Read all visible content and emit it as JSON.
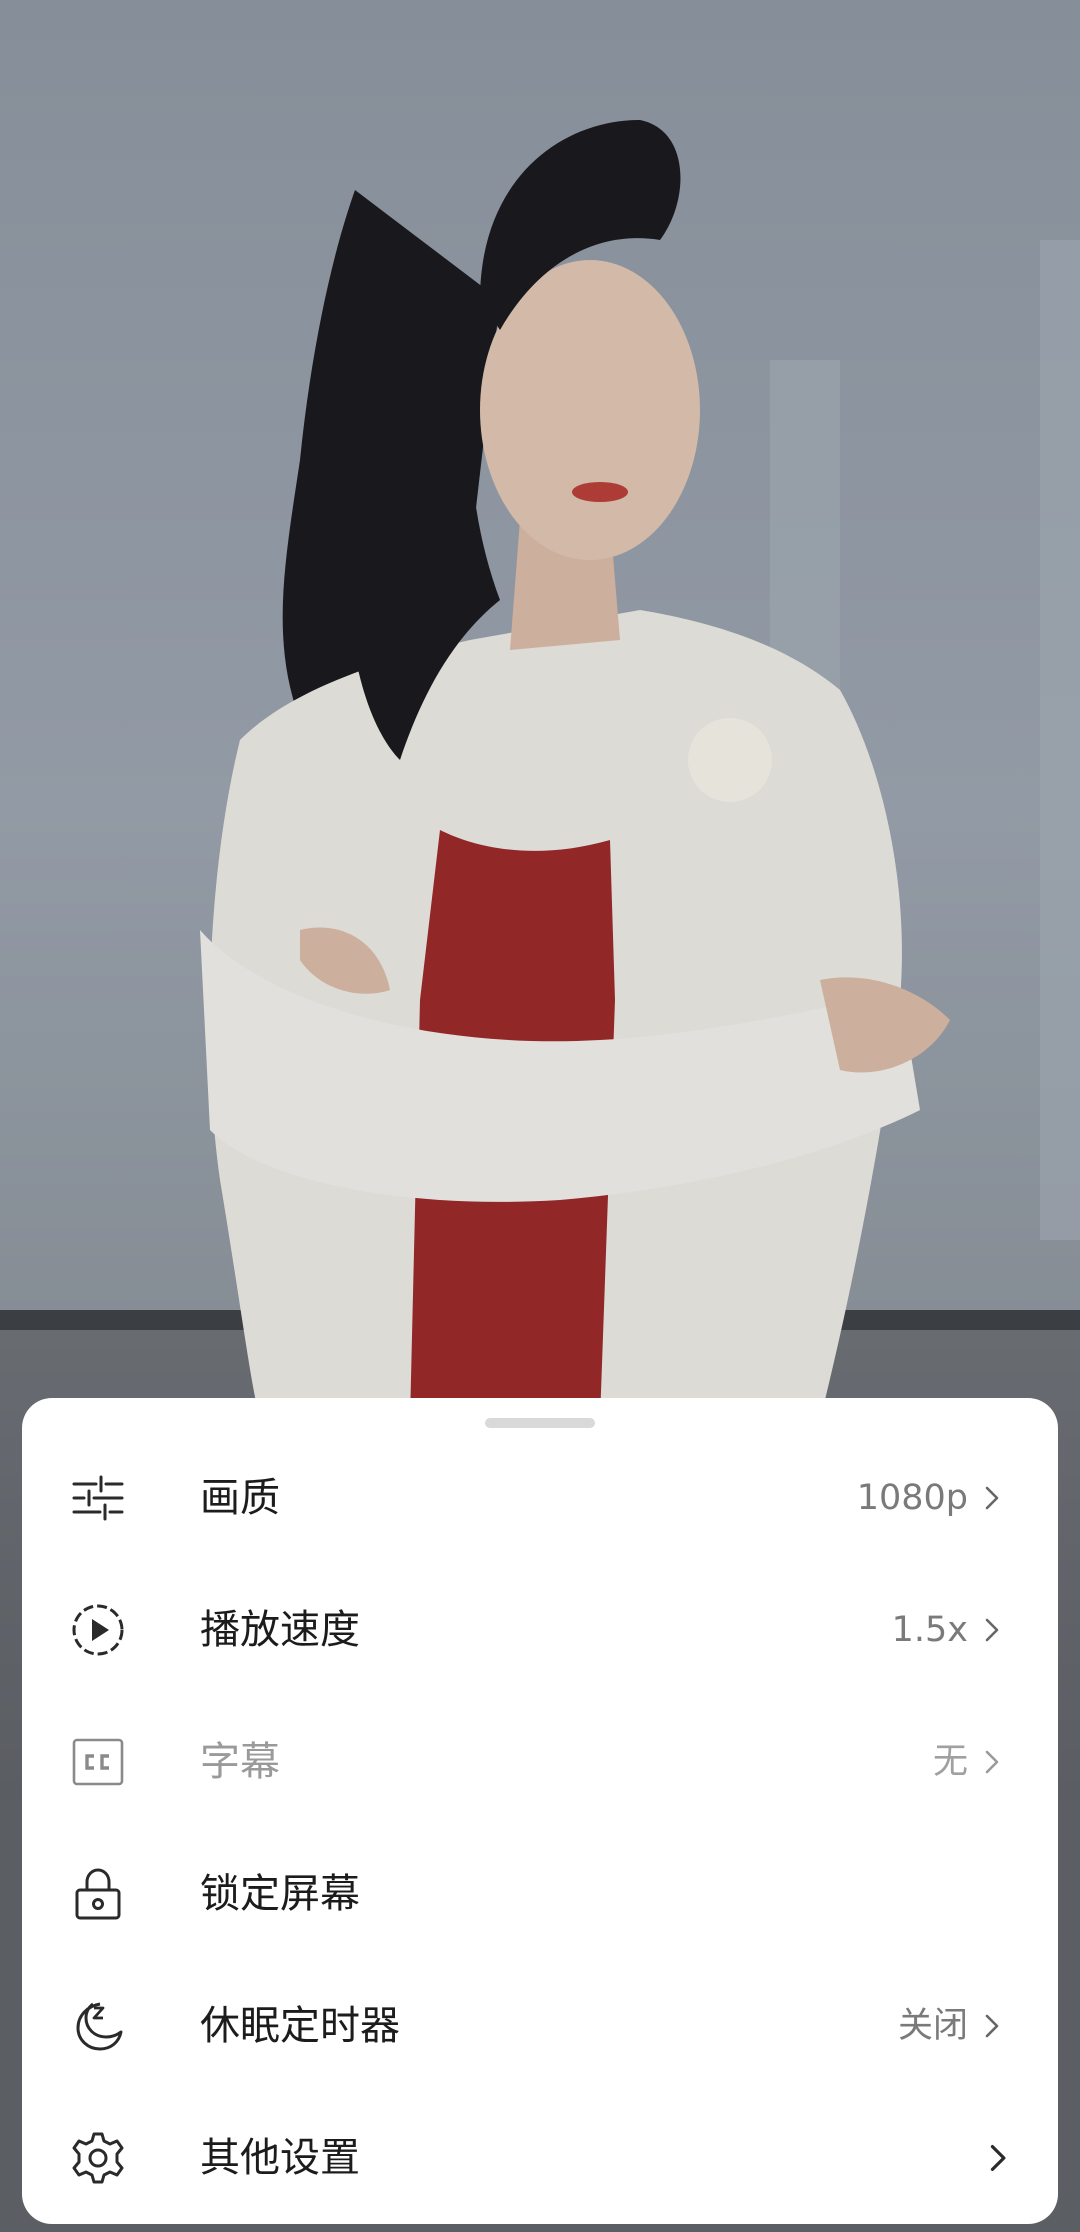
{
  "video": {
    "description_icon": "video-frame"
  },
  "sheet": {
    "items": [
      {
        "icon": "sliders-icon",
        "label": "画质",
        "value": "1080p",
        "has_chevron": true,
        "disabled": false
      },
      {
        "icon": "play-circle-icon",
        "label": "播放速度",
        "value": "1.5x",
        "has_chevron": true,
        "disabled": false
      },
      {
        "icon": "cc-icon",
        "label": "字幕",
        "value": "无",
        "has_chevron": true,
        "disabled": true
      },
      {
        "icon": "lock-icon",
        "label": "锁定屏幕",
        "value": "",
        "has_chevron": false,
        "disabled": false
      },
      {
        "icon": "sleep-moon-icon",
        "label": "休眠定时器",
        "value": "关闭",
        "has_chevron": true,
        "disabled": false
      },
      {
        "icon": "gear-icon",
        "label": "其他设置",
        "value": "",
        "has_chevron": true,
        "disabled": false
      }
    ]
  },
  "colors": {
    "sheet_background": "#ffffff",
    "label_text": "#1c1c1c",
    "value_text": "#7a7a7a",
    "disabled_text": "#9a9a9a"
  }
}
